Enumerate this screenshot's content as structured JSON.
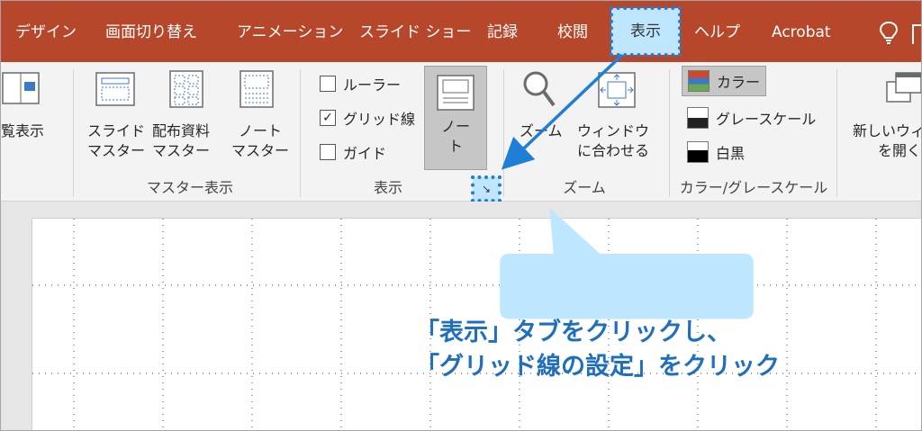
{
  "tabs": [
    {
      "id": "design",
      "label": "デザイン"
    },
    {
      "id": "transitions",
      "label": "画面切り替え"
    },
    {
      "id": "animations",
      "label": "アニメーション"
    },
    {
      "id": "slideshow",
      "label": "スライド ショー"
    },
    {
      "id": "record",
      "label": "記録"
    },
    {
      "id": "review",
      "label": "校閲"
    },
    {
      "id": "view",
      "label": "表示"
    },
    {
      "id": "help",
      "label": "ヘルプ"
    },
    {
      "id": "acrobat",
      "label": "Acrobat"
    }
  ],
  "ribbon": {
    "reading_view": "覧表示",
    "master_views": {
      "slide_master": [
        "スライド",
        "マスター"
      ],
      "handout_master": [
        "配布資料",
        "マスター"
      ],
      "notes_master": [
        "ノート",
        "マスター"
      ],
      "group_label": "マスター表示"
    },
    "show": {
      "ruler": {
        "label": "ルーラー",
        "checked": false
      },
      "gridlines": {
        "label": "グリッド線",
        "checked": true
      },
      "guides": {
        "label": "ガイド",
        "checked": false
      },
      "notes": [
        "ノ",
        "ー",
        "ト"
      ],
      "group_label": "表示",
      "launcher_glyph": "↘"
    },
    "zoom": {
      "zoom_label": "ズーム",
      "fit_window": [
        "ウィンドウ",
        "に合わせる"
      ],
      "group_label": "ズーム"
    },
    "color": {
      "color_label": "カラー",
      "grayscale_label": "グレースケール",
      "bw_label": "白黒",
      "group_label": "カラー/グレースケール"
    },
    "window": {
      "new_window": [
        "新しいウィ",
        "を開く"
      ]
    }
  },
  "callout": {
    "line1": "「表示」タブをクリックし、",
    "line2": "「グリッド線の設定」をクリック"
  },
  "colors": {
    "tab_bar": "#b7472a",
    "highlight": "#bfe6ff",
    "accent": "#1f7fd6",
    "callout_text": "#1f6fbf"
  }
}
